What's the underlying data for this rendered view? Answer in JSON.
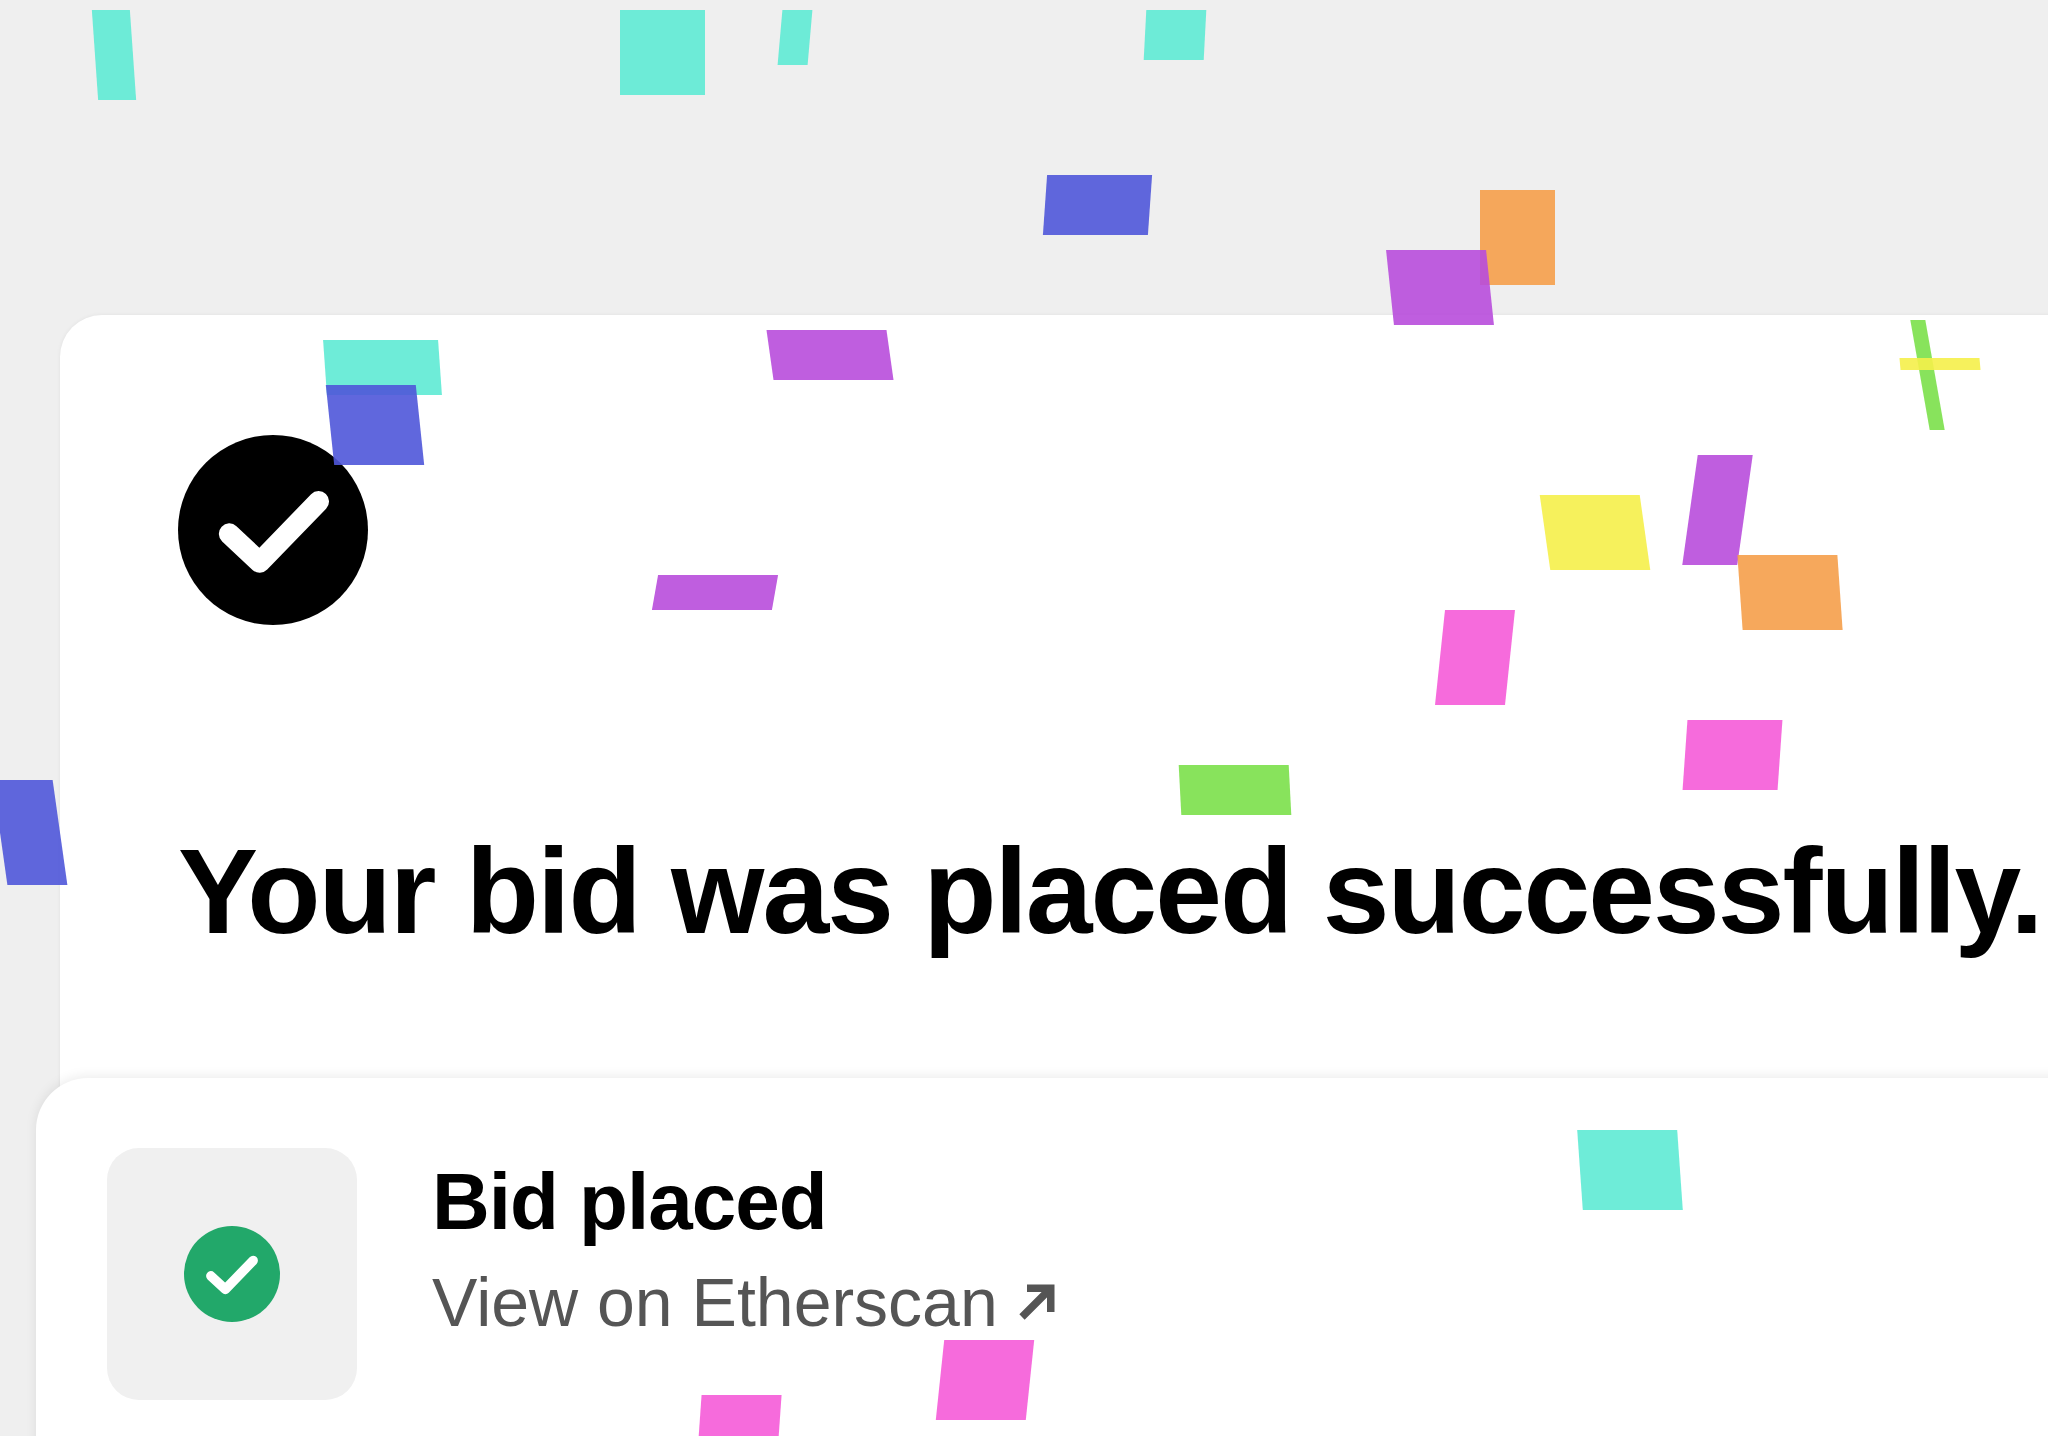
{
  "confirmation_card": {
    "title": "Your bid was placed successfully."
  },
  "toast": {
    "title": "Bid placed",
    "link": "View on Etherscan"
  }
}
